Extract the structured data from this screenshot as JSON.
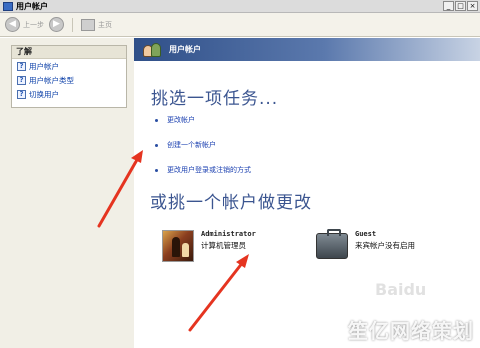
{
  "window": {
    "title": "用户帐户",
    "controls": [
      "_",
      "□",
      "×"
    ]
  },
  "toolbar": {
    "back_label": "上一步",
    "home_label": "主页"
  },
  "learn_panel": {
    "header": "了解",
    "items": [
      {
        "label": "用户帐户"
      },
      {
        "label": "用户帐户类型"
      },
      {
        "label": "切换用户"
      }
    ]
  },
  "main": {
    "header_title": "用户帐户",
    "pick_task": "挑选一项任务...",
    "tasks": [
      {
        "label": "更改帐户"
      },
      {
        "label": "创建一个新帐户"
      },
      {
        "label": "更改用户登录或注销的方式"
      }
    ],
    "pick_account": "或挑一个帐户做更改",
    "accounts": [
      {
        "name": "Administrator",
        "desc": "计算机管理员"
      },
      {
        "name": "Guest",
        "desc": "来宾帐户没有启用"
      }
    ]
  },
  "watermark": {
    "text": "笙亿网络策划",
    "faint": "Baidu"
  },
  "colors": {
    "accent": "#3b5590",
    "link": "#1a3fb0",
    "annotation": "#e53420"
  }
}
